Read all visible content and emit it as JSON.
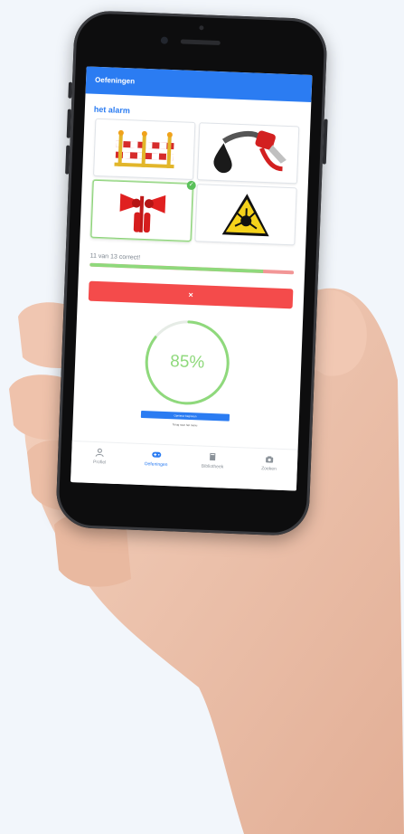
{
  "app": {
    "title": "Oefeningen"
  },
  "exercise": {
    "word": "het alarm",
    "options": [
      {
        "name": "road-barrier-image",
        "selected": false
      },
      {
        "name": "fuel-pump-image",
        "selected": false
      },
      {
        "name": "alarm-horns-image",
        "selected": true
      },
      {
        "name": "explosive-warning-sign-image",
        "selected": false
      }
    ],
    "selected_mark": "✓"
  },
  "progress": {
    "text": "11 van 13 correct!",
    "value": 0.85
  },
  "feedback_button": {
    "label": "×"
  },
  "score": {
    "percent_label": "85%",
    "value": 0.85,
    "color": "#8fd97c"
  },
  "actions": {
    "continue_label": "Opnieuw beginnen",
    "back_label": "Terug naar het menu"
  },
  "tabbar": {
    "items": [
      {
        "label": "Profiel",
        "icon": "person-icon",
        "active": false
      },
      {
        "label": "Oefeningen",
        "icon": "gamepad-icon",
        "active": true
      },
      {
        "label": "Bibliotheek",
        "icon": "book-icon",
        "active": false
      },
      {
        "label": "Zoeken",
        "icon": "camera-icon",
        "active": false
      }
    ]
  },
  "colors": {
    "accent": "#2b7cf2",
    "error": "#f44b4b",
    "success": "#8fd97c"
  }
}
